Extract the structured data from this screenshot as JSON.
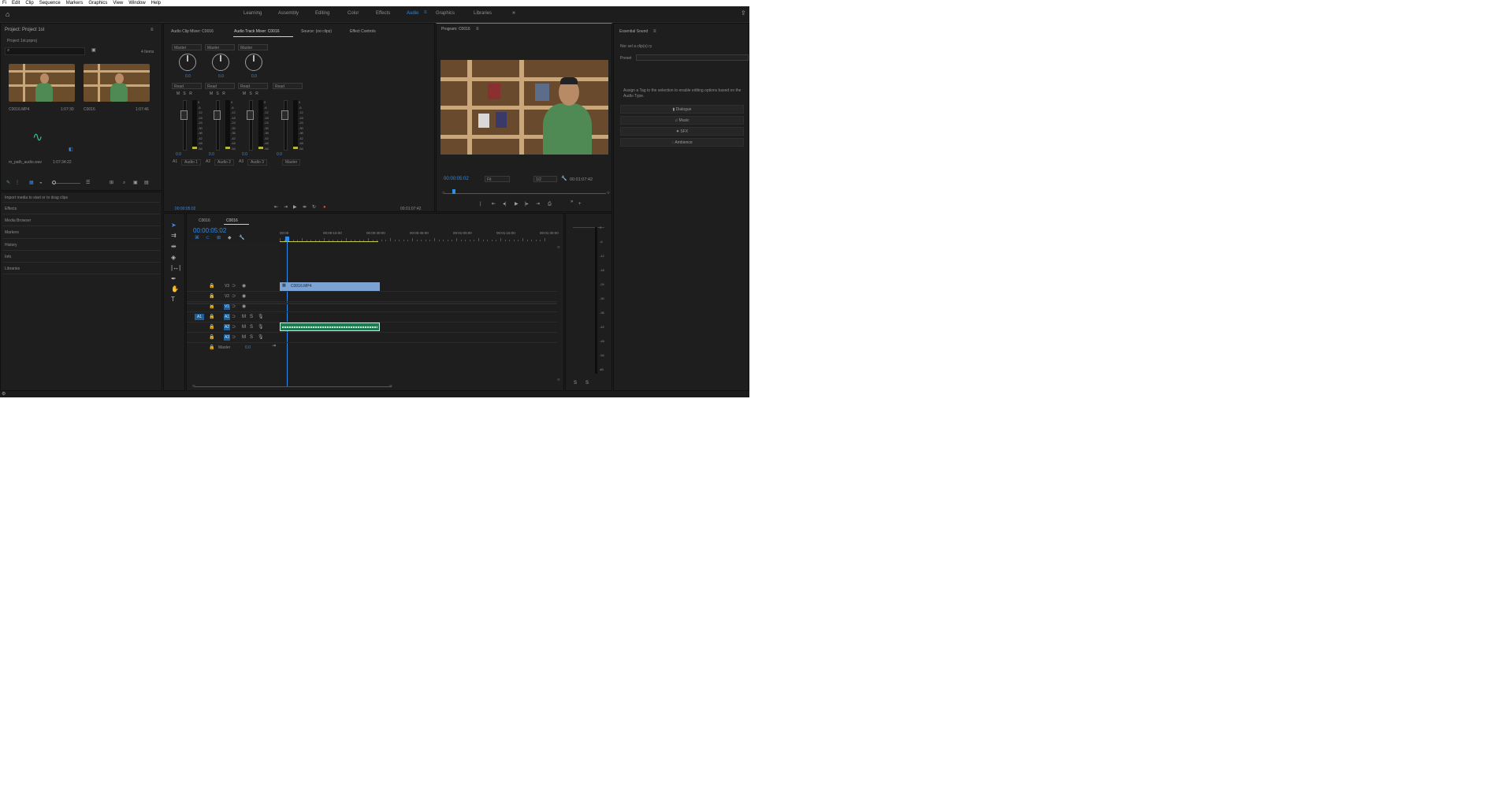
{
  "menu": [
    "Fi",
    "Edit",
    "Clip",
    "Sequence",
    "Markers",
    "Graphics",
    "View",
    "Window",
    "Help"
  ],
  "workspaces": {
    "tabs": [
      "Learning",
      "Assembly",
      "Editing",
      "Color",
      "Effects",
      "Audio",
      "Graphics",
      "Libraries"
    ],
    "active": "Audio",
    "more": "»"
  },
  "project": {
    "title": "Project: Project 1st",
    "subtitle": "Project 1st.prproj",
    "items_count": "4 Items",
    "clips": [
      {
        "name": "C0016.MP4",
        "duration": "1:07:30"
      },
      {
        "name": "C0016",
        "duration": "1:07:46"
      },
      {
        "name": "m_path_audio.wav",
        "duration": "1:07:34:22"
      }
    ],
    "drop_hint": "Import media to start or to drag clips",
    "lower_panels": [
      "Effects",
      "Media Browser",
      "Markers",
      "History",
      "Info",
      "Libraries"
    ]
  },
  "mixer": {
    "tabs": [
      "Audio Clip Mixer: C0016",
      "Audio Track Mixer: C0016",
      "Source: (no clips)",
      "Effect Controls"
    ],
    "active_tab": "Audio Track Mixer: C0016",
    "channels": [
      {
        "id": "A1",
        "name": "Audio 1",
        "value": "0.0",
        "read": "Read",
        "input": "Master"
      },
      {
        "id": "A2",
        "name": "Audio 2",
        "value": "0.0",
        "read": "Read",
        "input": "Master"
      },
      {
        "id": "A3",
        "name": "Audio 3",
        "value": "0.0",
        "read": "Read",
        "input": "Master"
      },
      {
        "id": "M",
        "name": "Master",
        "value": "0.0",
        "read": "Read",
        "input": ""
      }
    ],
    "db_scale": [
      "0",
      "-6",
      "-12",
      "-18",
      "-24",
      "-30",
      "-36",
      "-42",
      "-48",
      "-54"
    ],
    "timecode_in": "00:00:05:02",
    "timecode_out": "00:01:07:42"
  },
  "program": {
    "title": "Program: C0016",
    "timecode": "00:00:05:02",
    "fit": "Fit",
    "quality": "1/2",
    "duration": "00:01:07:42"
  },
  "essential_sound": {
    "title": "Essential Sound",
    "subtitle": "Nor sel a clip(s) ry",
    "preset_label": "Preset",
    "hint": "Assign a Tag to the selection to enable editing options based on the Audio Type.",
    "buttons": [
      "Dialogue",
      "Music",
      "SFX",
      "Ambience"
    ]
  },
  "timeline": {
    "tabs": [
      "C0016",
      "C0016"
    ],
    "timecode": "00:00:05:02",
    "ruler": [
      "00:00",
      "00:00:15:00",
      "00:00:30:00",
      "00:00:45:00",
      "00:01:00:00",
      "00:01:15:00",
      "00:01:30:00"
    ],
    "video_tracks": [
      "V3",
      "V2",
      "V1"
    ],
    "audio_tracks": [
      "A1",
      "A2",
      "A3"
    ],
    "master": {
      "label": "Master",
      "value": "0.0"
    },
    "video_clip": "C0016.MP4",
    "source_patch": "V1"
  },
  "colors": {
    "accent": "#2d8ceb",
    "video_clip": "#7aa2d2",
    "audio_clip": "#2aa06a",
    "record": "#e04444"
  }
}
